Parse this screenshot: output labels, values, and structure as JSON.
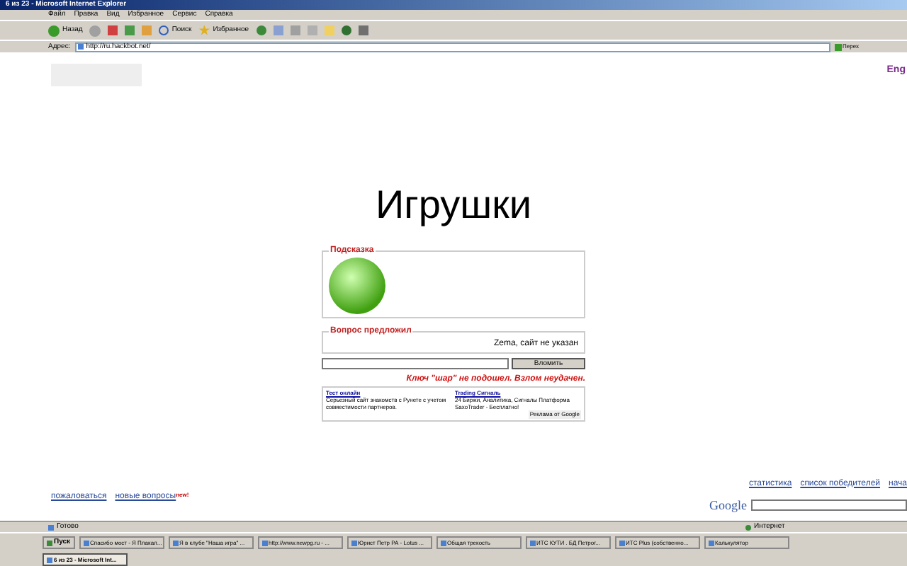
{
  "window": {
    "title": "6 из 23 - Microsoft Internet Explorer"
  },
  "menu": [
    "Файл",
    "Правка",
    "Вид",
    "Избранное",
    "Сервис",
    "Справка"
  ],
  "toolbar": {
    "back": "Назад",
    "search": "Поиск",
    "favorites": "Избранное"
  },
  "address": {
    "label": "Адрес:",
    "value": "http://ru.hackbot.net/",
    "go": "Перех"
  },
  "page": {
    "language_link": "Eng",
    "heading": "Игрушки",
    "hint": {
      "legend": "Подсказка"
    },
    "author": {
      "legend": "Вопрос предложил",
      "text": "Zema, сайт не указан"
    },
    "answer": {
      "button": "Вломить"
    },
    "error": "Ключ \"шар\" не подошел. Взлом неудачен.",
    "ads": [
      {
        "title": "Тест онлайн",
        "text": "Серьезный сайт знакомств с Рунете с учетом совместимости партнеров."
      },
      {
        "title": "Trading Сигналь",
        "text": "24 Биржи, Аналитика, Сигналы Платформа SaxoTrader - Бесплатно!"
      }
    ],
    "ads_label": "Реклама от Google",
    "footer_left": [
      {
        "text": "пожаловаться"
      },
      {
        "text": "новые вопросы",
        "badge": "new!"
      }
    ],
    "footer_right": [
      "статистика",
      "список победителей",
      "нача"
    ],
    "google_label": "Google"
  },
  "status_bar": {
    "text": "Готово",
    "zone": "Интернет"
  },
  "taskbar": {
    "start": "Пуск",
    "items": [
      {
        "label": "Спасибо мост - Я Плакал...",
        "selected": false
      },
      {
        "label": "Я в клубе \"Наша игра\" ...",
        "selected": false
      },
      {
        "label": "http://www.newpg.ru - ...",
        "selected": false
      },
      {
        "label": "Юрист Петр РА - Lotus ...",
        "selected": false
      },
      {
        "label": "Общая трекость",
        "selected": false
      },
      {
        "label": "ИТС КУТИ . БД Петрог...",
        "selected": false
      },
      {
        "label": "ИТС Plus (собственно...",
        "selected": false
      },
      {
        "label": "Калькулятор",
        "selected": false
      },
      {
        "label": "6 из 23 - Microsoft Int...",
        "selected": true
      }
    ]
  }
}
